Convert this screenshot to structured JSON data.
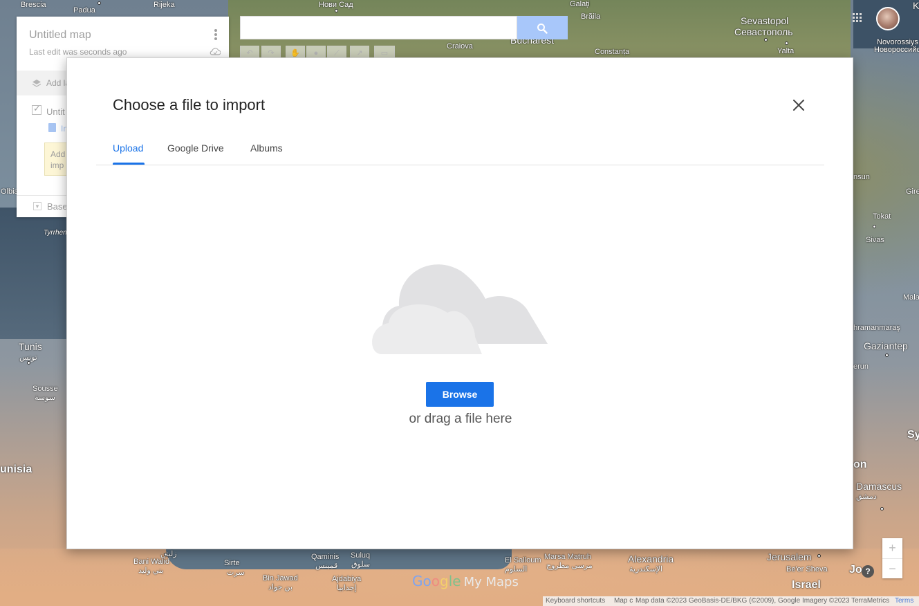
{
  "map": {
    "places": [
      {
        "name": "Brescia"
      },
      {
        "name": "Padua"
      },
      {
        "name": "Rijeka"
      },
      {
        "name": "Нови Сад"
      },
      {
        "name": "Galați"
      },
      {
        "name": "Brăila"
      },
      {
        "name": "Sevastopol"
      },
      {
        "name": "Севастополь"
      },
      {
        "name": "Novorossiys"
      },
      {
        "name": "Новороссийс"
      },
      {
        "name": "Craiova"
      },
      {
        "name": "Bucharest"
      },
      {
        "name": "Constanța"
      },
      {
        "name": "Yalta"
      },
      {
        "name": "Olbia"
      },
      {
        "name": "Tyrrhen"
      },
      {
        "name": "Tunis"
      },
      {
        "name": "تونس"
      },
      {
        "name": "Sousse"
      },
      {
        "name": "سوسة"
      },
      {
        "name": "unisia"
      },
      {
        "name": "Bani Walid"
      },
      {
        "name": "بني وليد"
      },
      {
        "name": "زليتن"
      },
      {
        "name": "Sirte"
      },
      {
        "name": "سرت"
      },
      {
        "name": "Qaminis"
      },
      {
        "name": "قمينس"
      },
      {
        "name": "Suluq"
      },
      {
        "name": "سلوق"
      },
      {
        "name": "Bin Jawad"
      },
      {
        "name": "بن جواد"
      },
      {
        "name": "Ajdabiya"
      },
      {
        "name": "إجدابيا"
      },
      {
        "name": "El Salloum"
      },
      {
        "name": "السلوم"
      },
      {
        "name": "Marsa Matruh"
      },
      {
        "name": "مرسى مطروح"
      },
      {
        "name": "Alexandria"
      },
      {
        "name": "الإسكندرية"
      },
      {
        "name": "Jerusalem"
      },
      {
        "name": "Be'er Sheva"
      },
      {
        "name": "Israel"
      },
      {
        "name": "Jo"
      },
      {
        "name": "Damascus"
      },
      {
        "name": "دمشق"
      },
      {
        "name": "Gaziantep"
      },
      {
        "name": "hramanmaraş"
      },
      {
        "name": "Sivas"
      },
      {
        "name": "Tokat"
      },
      {
        "name": "nsun"
      },
      {
        "name": "Gire"
      },
      {
        "name": "Mala"
      },
      {
        "name": "erun"
      },
      {
        "name": "on"
      },
      {
        "name": "Sy"
      },
      {
        "name": "K"
      }
    ]
  },
  "panel": {
    "title": "Untitled map",
    "subtitle": "Last edit was seconds ago",
    "add_layer_label": "Add la",
    "layer_name": "Untit",
    "import_label": "In",
    "tip_line1": "Add",
    "tip_line2": "imp",
    "basemap_label": "Base"
  },
  "search": {
    "value": "",
    "placeholder": ""
  },
  "toolbar": {
    "items": [
      {
        "name": "undo",
        "glyph": "↶"
      },
      {
        "name": "redo",
        "glyph": "↷"
      },
      {
        "name": "hand",
        "glyph": "✋"
      },
      {
        "name": "marker",
        "glyph": "●"
      },
      {
        "name": "line",
        "glyph": "⟋"
      },
      {
        "name": "directions",
        "glyph": "↗"
      },
      {
        "name": "measure",
        "glyph": "▭"
      }
    ]
  },
  "dialog": {
    "title": "Choose a file to import",
    "tabs": [
      {
        "label": "Upload",
        "active": true
      },
      {
        "label": "Google Drive",
        "active": false
      },
      {
        "label": "Albums",
        "active": false
      }
    ],
    "browse_label": "Browse",
    "drag_text": "or drag a file here"
  },
  "zoom": {
    "in": "+",
    "out": "−"
  },
  "help": {
    "label": "?"
  },
  "logo": {
    "g1": "Go",
    "g2": "o",
    "g3": "g",
    "g4": "le",
    "product": "My Maps"
  },
  "footer": {
    "shortcuts": "Keyboard shortcuts",
    "mapdata_short": "Map c",
    "attribution": "Map data ©2023 GeoBasis-DE/BKG (©2009), Google Imagery ©2023 TerraMetrics",
    "terms": "Terms"
  },
  "colors": {
    "accent": "#1a73e8",
    "tab_inactive": "#444444",
    "dialog_bg": "#ffffff"
  }
}
